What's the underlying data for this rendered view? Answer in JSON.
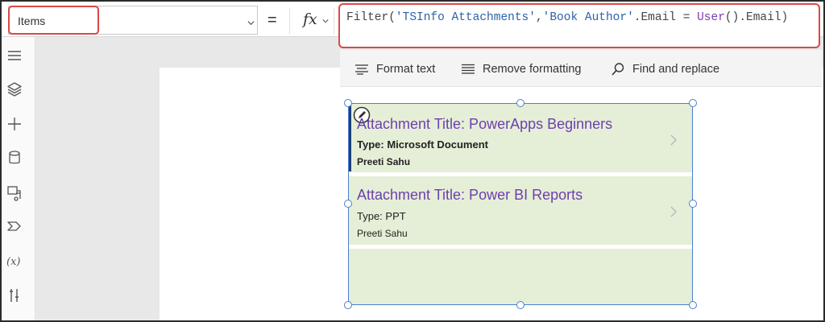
{
  "formula_bar": {
    "property_value": "Items",
    "equals": "=",
    "fx_label": "fx",
    "formula": {
      "part1": "Filter(",
      "part2": "'TSInfo Attachments'",
      "part3": ",",
      "part4": "'Book Author'",
      "part5": ".Email = ",
      "part6": "User",
      "part7": "().Email)"
    }
  },
  "toolbar": {
    "format_text": "Format text",
    "remove_formatting": "Remove formatting",
    "find_replace": "Find and replace"
  },
  "gallery": {
    "items": [
      {
        "title": "Attachment Title: PowerApps Beginners",
        "type": "Type: Microsoft Document",
        "author": "Preeti Sahu"
      },
      {
        "title": "Attachment Title: Power BI Reports",
        "type": "Type: PPT",
        "author": "Preeti Sahu"
      }
    ]
  },
  "colors": {
    "highlight": "#d94848",
    "gallery_bg": "#e5efd7",
    "title_purple": "#6d3fb0",
    "selection": "#4a7fcf"
  },
  "icons": [
    "chevron-down-icon",
    "hamburger-icon",
    "layers-icon",
    "plus-icon",
    "data-icon",
    "media-icon",
    "flow-icon",
    "variables-icon",
    "tools-icon",
    "format-text-icon",
    "remove-formatting-icon",
    "search-icon",
    "edit-icon",
    "chevron-right-icon"
  ]
}
